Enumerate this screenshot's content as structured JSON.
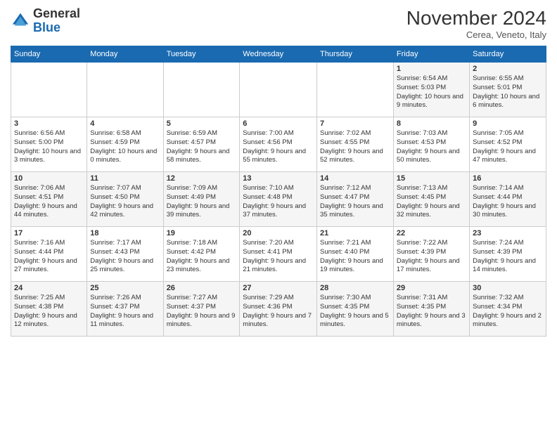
{
  "header": {
    "logo_general": "General",
    "logo_blue": "Blue",
    "month_title": "November 2024",
    "location": "Cerea, Veneto, Italy"
  },
  "weekdays": [
    "Sunday",
    "Monday",
    "Tuesday",
    "Wednesday",
    "Thursday",
    "Friday",
    "Saturday"
  ],
  "weeks": [
    [
      {
        "day": "",
        "info": ""
      },
      {
        "day": "",
        "info": ""
      },
      {
        "day": "",
        "info": ""
      },
      {
        "day": "",
        "info": ""
      },
      {
        "day": "",
        "info": ""
      },
      {
        "day": "1",
        "info": "Sunrise: 6:54 AM\nSunset: 5:03 PM\nDaylight: 10 hours and 9 minutes."
      },
      {
        "day": "2",
        "info": "Sunrise: 6:55 AM\nSunset: 5:01 PM\nDaylight: 10 hours and 6 minutes."
      }
    ],
    [
      {
        "day": "3",
        "info": "Sunrise: 6:56 AM\nSunset: 5:00 PM\nDaylight: 10 hours and 3 minutes."
      },
      {
        "day": "4",
        "info": "Sunrise: 6:58 AM\nSunset: 4:59 PM\nDaylight: 10 hours and 0 minutes."
      },
      {
        "day": "5",
        "info": "Sunrise: 6:59 AM\nSunset: 4:57 PM\nDaylight: 9 hours and 58 minutes."
      },
      {
        "day": "6",
        "info": "Sunrise: 7:00 AM\nSunset: 4:56 PM\nDaylight: 9 hours and 55 minutes."
      },
      {
        "day": "7",
        "info": "Sunrise: 7:02 AM\nSunset: 4:55 PM\nDaylight: 9 hours and 52 minutes."
      },
      {
        "day": "8",
        "info": "Sunrise: 7:03 AM\nSunset: 4:53 PM\nDaylight: 9 hours and 50 minutes."
      },
      {
        "day": "9",
        "info": "Sunrise: 7:05 AM\nSunset: 4:52 PM\nDaylight: 9 hours and 47 minutes."
      }
    ],
    [
      {
        "day": "10",
        "info": "Sunrise: 7:06 AM\nSunset: 4:51 PM\nDaylight: 9 hours and 44 minutes."
      },
      {
        "day": "11",
        "info": "Sunrise: 7:07 AM\nSunset: 4:50 PM\nDaylight: 9 hours and 42 minutes."
      },
      {
        "day": "12",
        "info": "Sunrise: 7:09 AM\nSunset: 4:49 PM\nDaylight: 9 hours and 39 minutes."
      },
      {
        "day": "13",
        "info": "Sunrise: 7:10 AM\nSunset: 4:48 PM\nDaylight: 9 hours and 37 minutes."
      },
      {
        "day": "14",
        "info": "Sunrise: 7:12 AM\nSunset: 4:47 PM\nDaylight: 9 hours and 35 minutes."
      },
      {
        "day": "15",
        "info": "Sunrise: 7:13 AM\nSunset: 4:45 PM\nDaylight: 9 hours and 32 minutes."
      },
      {
        "day": "16",
        "info": "Sunrise: 7:14 AM\nSunset: 4:44 PM\nDaylight: 9 hours and 30 minutes."
      }
    ],
    [
      {
        "day": "17",
        "info": "Sunrise: 7:16 AM\nSunset: 4:44 PM\nDaylight: 9 hours and 27 minutes."
      },
      {
        "day": "18",
        "info": "Sunrise: 7:17 AM\nSunset: 4:43 PM\nDaylight: 9 hours and 25 minutes."
      },
      {
        "day": "19",
        "info": "Sunrise: 7:18 AM\nSunset: 4:42 PM\nDaylight: 9 hours and 23 minutes."
      },
      {
        "day": "20",
        "info": "Sunrise: 7:20 AM\nSunset: 4:41 PM\nDaylight: 9 hours and 21 minutes."
      },
      {
        "day": "21",
        "info": "Sunrise: 7:21 AM\nSunset: 4:40 PM\nDaylight: 9 hours and 19 minutes."
      },
      {
        "day": "22",
        "info": "Sunrise: 7:22 AM\nSunset: 4:39 PM\nDaylight: 9 hours and 17 minutes."
      },
      {
        "day": "23",
        "info": "Sunrise: 7:24 AM\nSunset: 4:39 PM\nDaylight: 9 hours and 14 minutes."
      }
    ],
    [
      {
        "day": "24",
        "info": "Sunrise: 7:25 AM\nSunset: 4:38 PM\nDaylight: 9 hours and 12 minutes."
      },
      {
        "day": "25",
        "info": "Sunrise: 7:26 AM\nSunset: 4:37 PM\nDaylight: 9 hours and 11 minutes."
      },
      {
        "day": "26",
        "info": "Sunrise: 7:27 AM\nSunset: 4:37 PM\nDaylight: 9 hours and 9 minutes."
      },
      {
        "day": "27",
        "info": "Sunrise: 7:29 AM\nSunset: 4:36 PM\nDaylight: 9 hours and 7 minutes."
      },
      {
        "day": "28",
        "info": "Sunrise: 7:30 AM\nSunset: 4:35 PM\nDaylight: 9 hours and 5 minutes."
      },
      {
        "day": "29",
        "info": "Sunrise: 7:31 AM\nSunset: 4:35 PM\nDaylight: 9 hours and 3 minutes."
      },
      {
        "day": "30",
        "info": "Sunrise: 7:32 AM\nSunset: 4:34 PM\nDaylight: 9 hours and 2 minutes."
      }
    ]
  ]
}
